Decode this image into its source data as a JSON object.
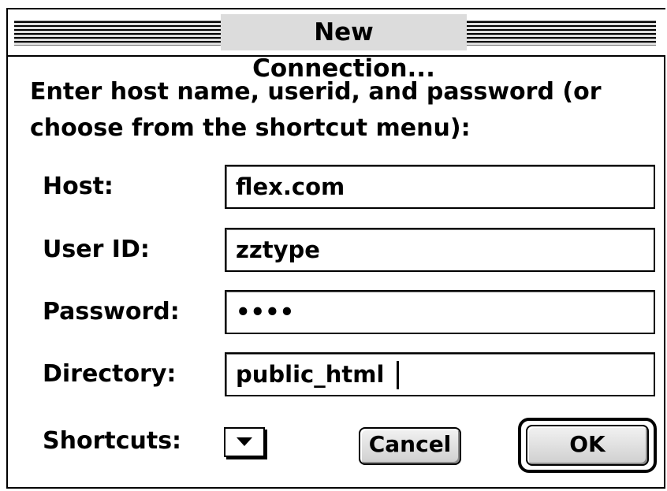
{
  "window": {
    "title": "New Connection..."
  },
  "prompt": {
    "line1": "Enter host name, userid, and password (or",
    "line2": "choose from the shortcut menu):"
  },
  "fields": {
    "host": {
      "label": "Host:",
      "value": "flex.com"
    },
    "user_id": {
      "label": "User ID:",
      "value": "zztype"
    },
    "password": {
      "label": "Password:",
      "value": "••••"
    },
    "directory": {
      "label": "Directory:",
      "value": "public_html"
    }
  },
  "shortcuts": {
    "label": "Shortcuts:",
    "icon": "chevron-down-icon"
  },
  "buttons": {
    "cancel_label": "Cancel",
    "ok_label": "OK",
    "default": "ok"
  },
  "colors": {
    "background": "#ffffff",
    "title_stripes": "#000000",
    "button_face": "#dcdcdc"
  }
}
